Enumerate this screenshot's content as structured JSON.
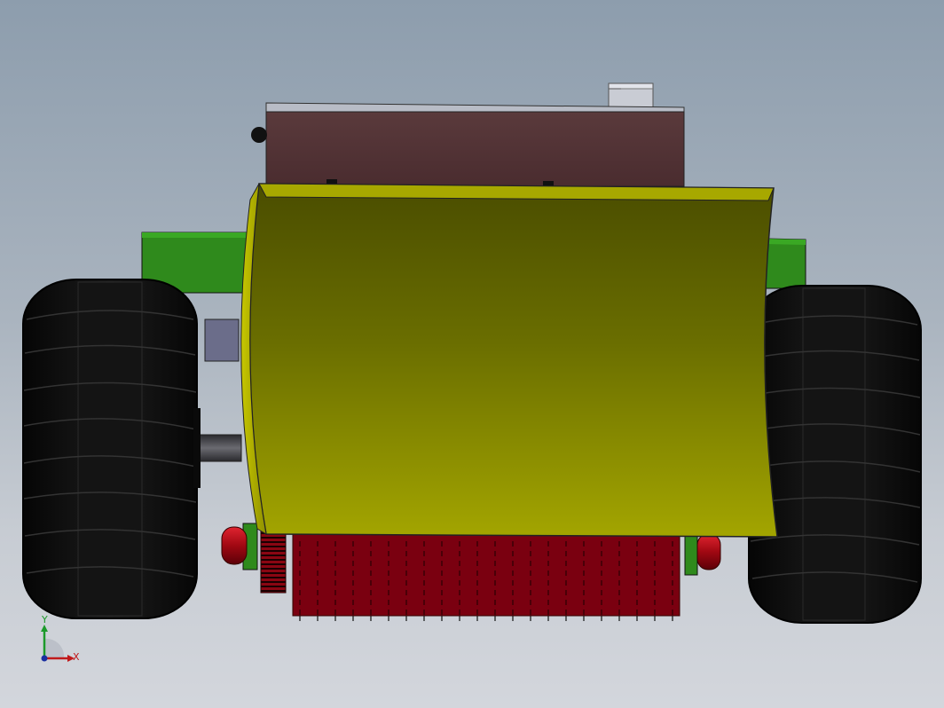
{
  "viewport": {
    "background_top": "#8d9dad",
    "background_bottom": "#d3d6dc"
  },
  "model": {
    "parts": [
      "engine-housing",
      "sensor-box",
      "green-chassis",
      "snow-blade",
      "left-wheel",
      "right-wheel",
      "brush-roller",
      "gear",
      "axle",
      "side-bracket"
    ],
    "colors": {
      "blade_top": "#4e5200",
      "blade_bottom": "#a4a600",
      "blade_edge": "#c9c800",
      "housing": "#4f3033",
      "chassis": "#2f8a1c",
      "tire": "#0d0d0d",
      "brush": "#7a0010",
      "roller_end": "#c20d1a"
    }
  },
  "triad": {
    "x_label": "X",
    "y_label": "Y",
    "x_color": "#c0181a",
    "y_color": "#1c9a2b",
    "z_color": "#1a2fa0"
  }
}
